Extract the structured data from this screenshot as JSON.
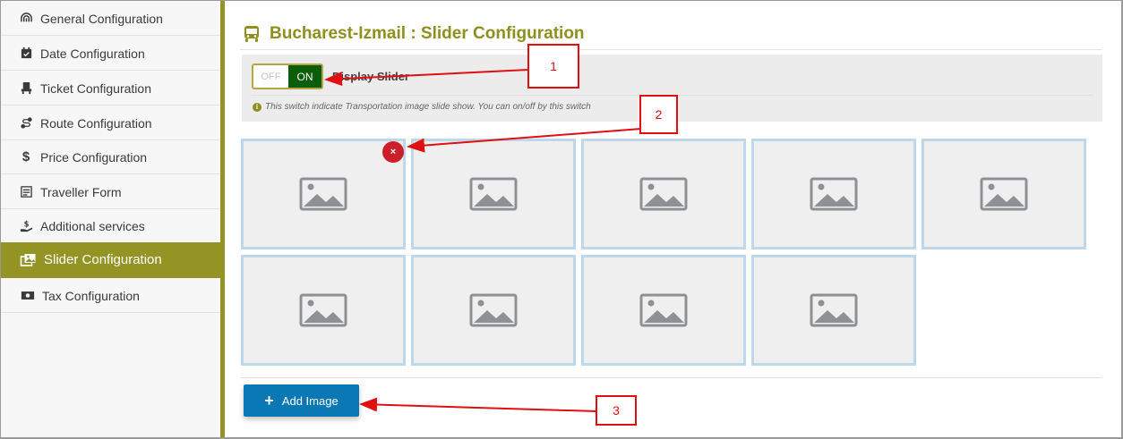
{
  "sidebar": {
    "items": [
      {
        "label": "General Configuration",
        "icon": "fingerprint-icon",
        "active": false
      },
      {
        "label": "Date Configuration",
        "icon": "calendar-check-icon",
        "active": false
      },
      {
        "label": "Ticket Configuration",
        "icon": "seat-icon",
        "active": false
      },
      {
        "label": "Route Configuration",
        "icon": "route-icon",
        "active": false
      },
      {
        "label": "Price Configuration",
        "icon": "dollar-icon",
        "active": false
      },
      {
        "label": "Traveller Form",
        "icon": "form-icon",
        "active": false
      },
      {
        "label": "Additional services",
        "icon": "hand-dollar-icon",
        "active": false
      },
      {
        "label": "Slider Configuration",
        "icon": "images-icon",
        "active": true
      },
      {
        "label": "Tax Configuration",
        "icon": "money-bill-icon",
        "active": false
      }
    ]
  },
  "header": {
    "title": "Bucharest-Izmail : Slider Configuration",
    "icon": "bus-icon"
  },
  "display_slider": {
    "off_label": "OFF",
    "on_label": "ON",
    "state": "ON",
    "label": "Display Slider",
    "hint": "This switch indicate Transportation image slide show. You can on/off by this switch"
  },
  "gallery": {
    "image_count": 9,
    "placeholder_icon": "image-placeholder-icon",
    "remove_label": "×"
  },
  "actions": {
    "add_image_label": "Add Image"
  },
  "annotations": [
    "1",
    "2",
    "3"
  ],
  "colors": {
    "accent": "#949425",
    "title": "#8f8f1e",
    "toggle_on": "#0a5e0a",
    "add_button": "#0a78b4",
    "remove_button": "#cc1f2a",
    "annotation": "#e01010"
  }
}
